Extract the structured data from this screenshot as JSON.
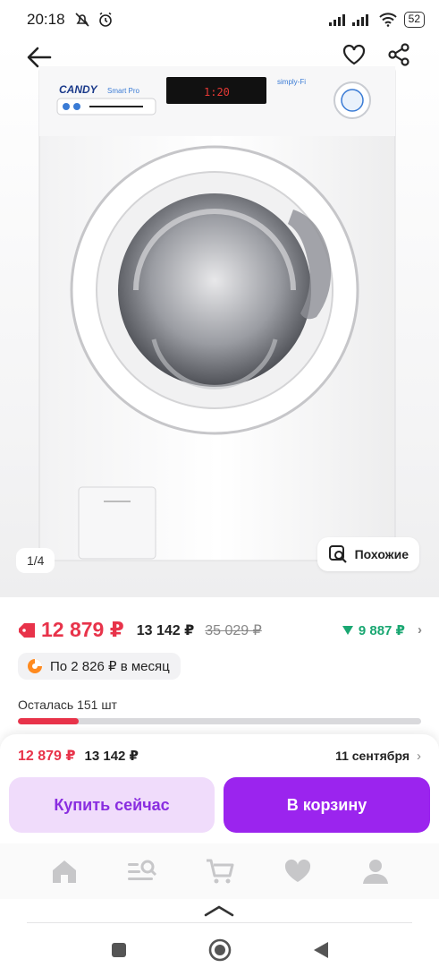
{
  "status_bar": {
    "time": "20:18",
    "signal": "..ııl ..ııl",
    "battery": "52"
  },
  "gallery": {
    "pager": "1/4",
    "similar_label": "Похожие",
    "washer_brand": "CANDY",
    "washer_series": "Smart Pro",
    "washer_display": "1:20",
    "washer_badge": "simply-Fi"
  },
  "price": {
    "main": "12 879 ₽",
    "secondary": "13 142 ₽",
    "old": "35 029 ₽",
    "cashback": "9 887 ₽"
  },
  "installment": {
    "label": "По 2 826 ₽ в месяц"
  },
  "stock": {
    "label": "Осталась 151 шт",
    "fraction": 0.15
  },
  "sheet": {
    "price": "12 879 ₽",
    "price_secondary": "13 142 ₽",
    "delivery_date": "11 сентября",
    "buy_now": "Купить сейчас",
    "add_to_cart": "В корзину"
  },
  "colors": {
    "accent": "#9b24ee",
    "price_red": "#e8334a",
    "cashback_green": "#1aa772"
  },
  "tabs": [
    {
      "icon": "home-icon"
    },
    {
      "icon": "catalog-search-icon"
    },
    {
      "icon": "cart-icon"
    },
    {
      "icon": "heart-icon"
    },
    {
      "icon": "profile-icon"
    }
  ]
}
